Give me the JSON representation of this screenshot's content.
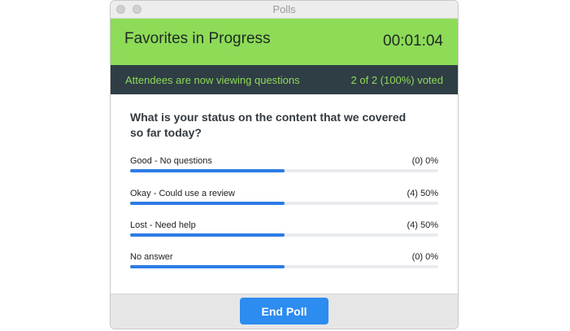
{
  "window": {
    "title": "Polls"
  },
  "banner": {
    "poll_name": "Favorites in Progress",
    "timer": "00:01:04",
    "color": "#8ddb57"
  },
  "status": {
    "message": "Attendees are now viewing questions",
    "vote_count": "2 of 2 (100%) voted",
    "background": "#2f3d45"
  },
  "question": {
    "text": "What is your status on the content that we covered so far today?"
  },
  "answers": [
    {
      "label": "Good - No questions",
      "result": "(0) 0%",
      "fill_fraction": 0.5
    },
    {
      "label": "Okay - Could use a review",
      "result": "(4) 50%",
      "fill_fraction": 0.5
    },
    {
      "label": "Lost - Need help",
      "result": "(4) 50%",
      "fill_fraction": 0.5
    },
    {
      "label": "No answer",
      "result": "(0) 0%",
      "fill_fraction": 0.5
    }
  ],
  "footer": {
    "end_button_label": "End Poll",
    "button_color": "#2d8cf0"
  }
}
